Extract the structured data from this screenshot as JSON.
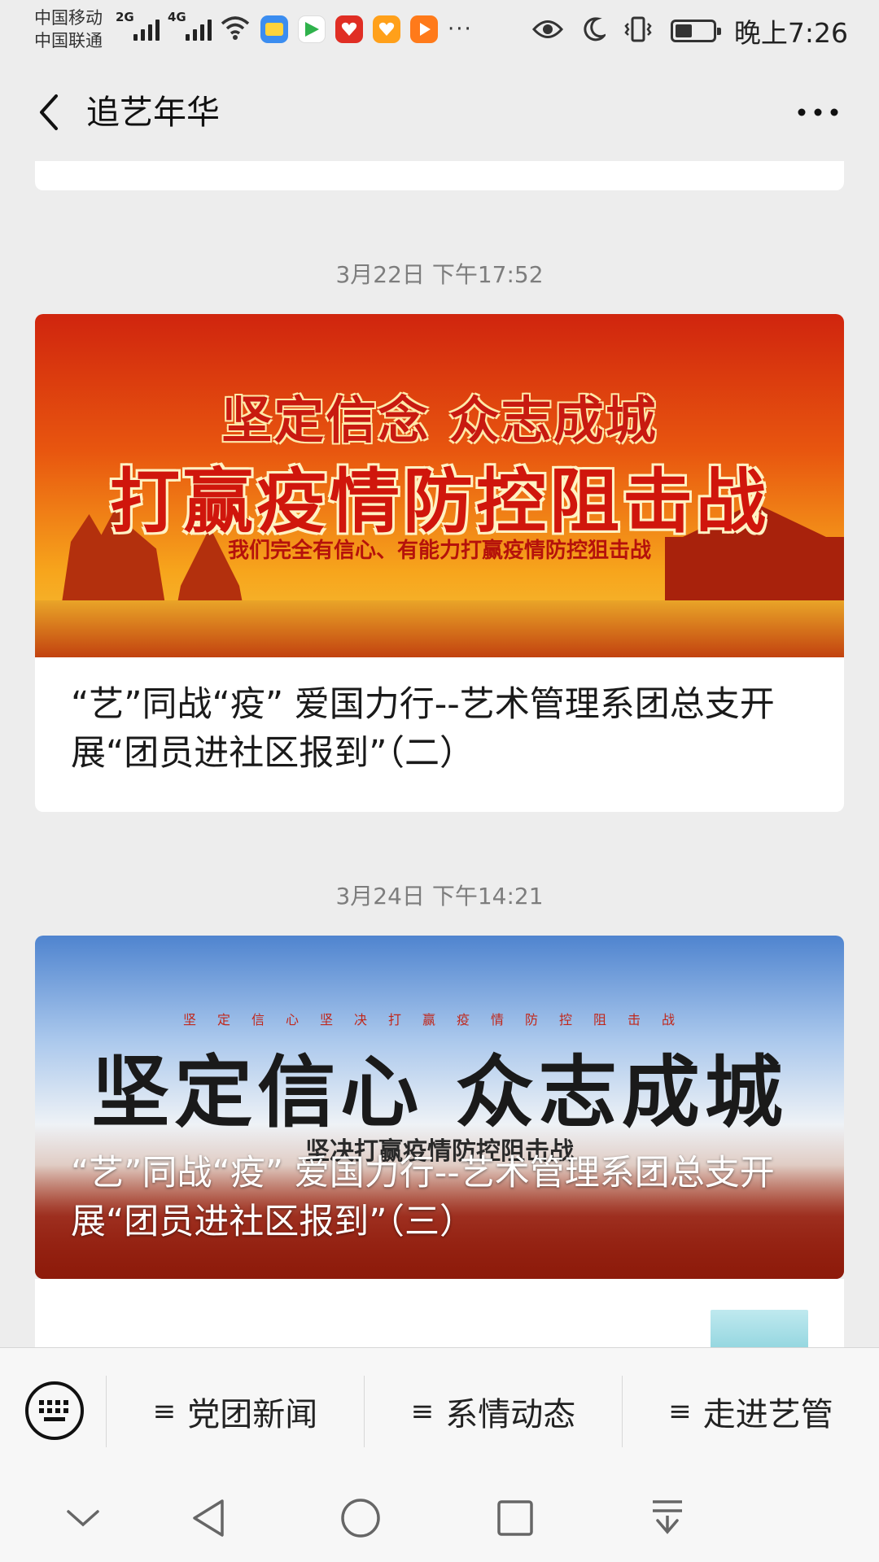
{
  "status_bar": {
    "carrier1": "中国移动",
    "carrier2": "中国联通",
    "sig1_gen": "2G",
    "sig2_gen": "4G",
    "more": "···",
    "time": "晚上7:26",
    "battery_level": 0.45,
    "icons": [
      "wifi-icon",
      "wallet-app-icon",
      "video-app-icon",
      "pinduoduo-app-icon",
      "shop-app-icon",
      "media-app-icon",
      "eye-icon",
      "moon-icon",
      "vibrate-icon",
      "battery-icon"
    ]
  },
  "nav": {
    "title": "追艺年华",
    "back_icon": "chevron-left-icon",
    "more_icon": "more-dots-icon"
  },
  "feed": [
    {
      "timestamp": "3月22日 下午17:52",
      "banner": {
        "line1": "坚定信念 众志成城",
        "line2": "打赢疫情防控阻击战",
        "line3": "我们完全有信心、有能力打赢疫情防控狙击战"
      },
      "title": "“艺”同战“疫” 爱国力行--艺术管理系团总支开展“团员进社区报到”（二）"
    },
    {
      "timestamp": "3月24日 下午14:21",
      "banner": {
        "small": "坚定信心坚决打赢疫情防控阻击战",
        "big": "坚定信心 众志成城",
        "sub": "坚决打赢疫情防控阻击战"
      },
      "title": "“艺”同战“疫” 爱国力行--艺术管理系团总支开展“团员进社区报到”（三）"
    }
  ],
  "menu": {
    "keyboard_icon": "keyboard-icon",
    "items": [
      {
        "label": "党团新闻"
      },
      {
        "label": "系情动态"
      },
      {
        "label": "走进艺管"
      }
    ],
    "item_icon": "≡"
  },
  "system_nav": [
    "chevron-down-icon",
    "back-triangle-icon",
    "home-circle-icon",
    "recents-square-icon",
    "notification-pull-icon"
  ]
}
